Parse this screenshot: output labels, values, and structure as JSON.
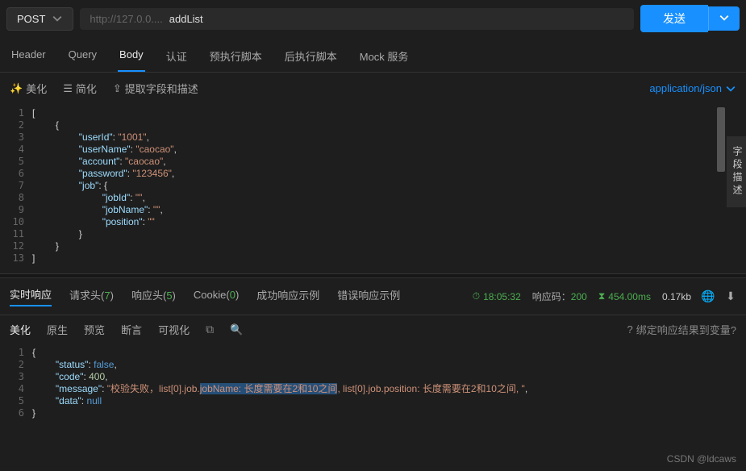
{
  "request": {
    "method": "POST",
    "url_hint": "http://127.0.0....",
    "url_path": "addList",
    "send_label": "发送"
  },
  "req_tabs": [
    "Header",
    "Query",
    "Body",
    "认证",
    "预执行脚本",
    "后执行脚本",
    "Mock 服务"
  ],
  "req_tab_active": 2,
  "body_toolbar": {
    "beautify": "美化",
    "simplify": "简化",
    "extract": "提取字段和描述",
    "content_type": "application/json"
  },
  "side_label": "字段描述",
  "body_code": [
    "[",
    "    {",
    "        \"userId\": \"1001\",",
    "        \"userName\": \"caocao\",",
    "        \"account\": \"caocao\",",
    "        \"password\": \"123456\",",
    "        \"job\": {",
    "            \"jobId\": \"\",",
    "            \"jobName\": \"\",",
    "            \"position\": \"\"",
    "        }",
    "    }",
    "]"
  ],
  "resp_tabs": {
    "realtime": "实时响应",
    "req_header": "请求头",
    "req_header_cnt": "7",
    "resp_header": "响应头",
    "resp_header_cnt": "5",
    "cookie": "Cookie",
    "cookie_cnt": "0",
    "success_ex": "成功响应示例",
    "error_ex": "错误响应示例"
  },
  "resp_meta": {
    "time": "18:05:32",
    "code_label": "响应码：",
    "code": "200",
    "duration": "454.00ms",
    "size": "0.17kb"
  },
  "view_tabs": [
    "美化",
    "原生",
    "预览",
    "断言",
    "可视化"
  ],
  "view_tab_active": 0,
  "bind_link": "绑定响应结果到变量?",
  "resp_body": {
    "l1": "{",
    "l2_k": "\"status\"",
    "l2_v": "false",
    "l3_k": "\"code\"",
    "l3_v": "400",
    "l4_k": "\"message\"",
    "l4_pre": "\"校验失败，list[0].job.",
    "l4_sel": "jobName: 长度需要在2和10之间",
    "l4_post": ", list[0].job.position: 长度需要在2和10之间, \"",
    "l5_k": "\"data\"",
    "l5_v": "null",
    "l6": "}"
  },
  "watermark": "CSDN @ldcaws"
}
